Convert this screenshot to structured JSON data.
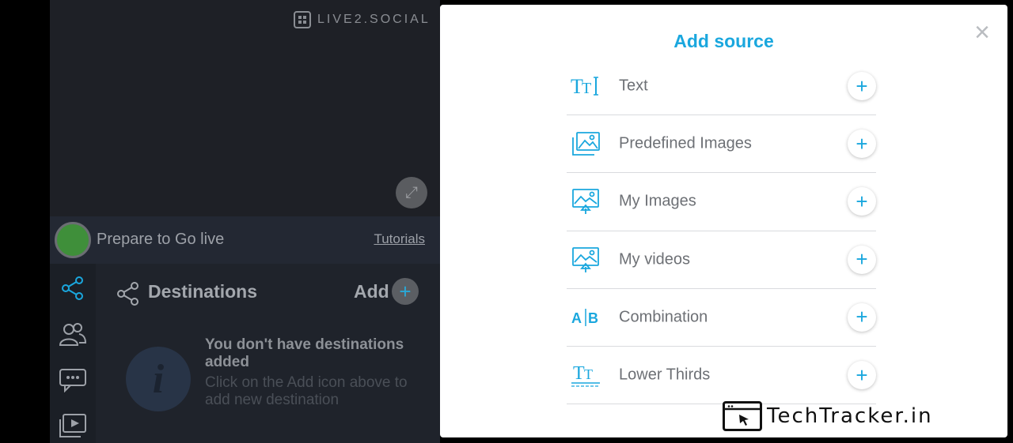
{
  "app": {
    "logo_text": "LIVE2.SOCIAL",
    "status_text": "Prepare to Go live",
    "tutorials_link": "Tutorials",
    "status_color": "#3f8f3a"
  },
  "destinations": {
    "title": "Destinations",
    "add_label": "Add",
    "empty_title": "You don't have destinations added",
    "empty_subtitle": "Click on the Add icon above to add new destination"
  },
  "sidebar": {
    "items": [
      {
        "icon": "share-icon",
        "active": true
      },
      {
        "icon": "users-icon",
        "active": false
      },
      {
        "icon": "chat-icon",
        "active": false
      },
      {
        "icon": "video-library-icon",
        "active": false
      }
    ]
  },
  "modal": {
    "title": "Add source",
    "close_symbol": "×",
    "items": [
      {
        "label": "Text",
        "icon": "text-icon"
      },
      {
        "label": "Predefined Images",
        "icon": "images-icon"
      },
      {
        "label": "My Images",
        "icon": "upload-image-icon"
      },
      {
        "label": "My videos",
        "icon": "upload-video-icon"
      },
      {
        "label": "Combination",
        "icon": "combination-icon"
      },
      {
        "label": "Lower Thirds",
        "icon": "lower-thirds-icon"
      }
    ]
  },
  "watermark": {
    "text": "TechTracker.in"
  },
  "colors": {
    "accent": "#1aa7de",
    "panel": "#1d2129"
  }
}
